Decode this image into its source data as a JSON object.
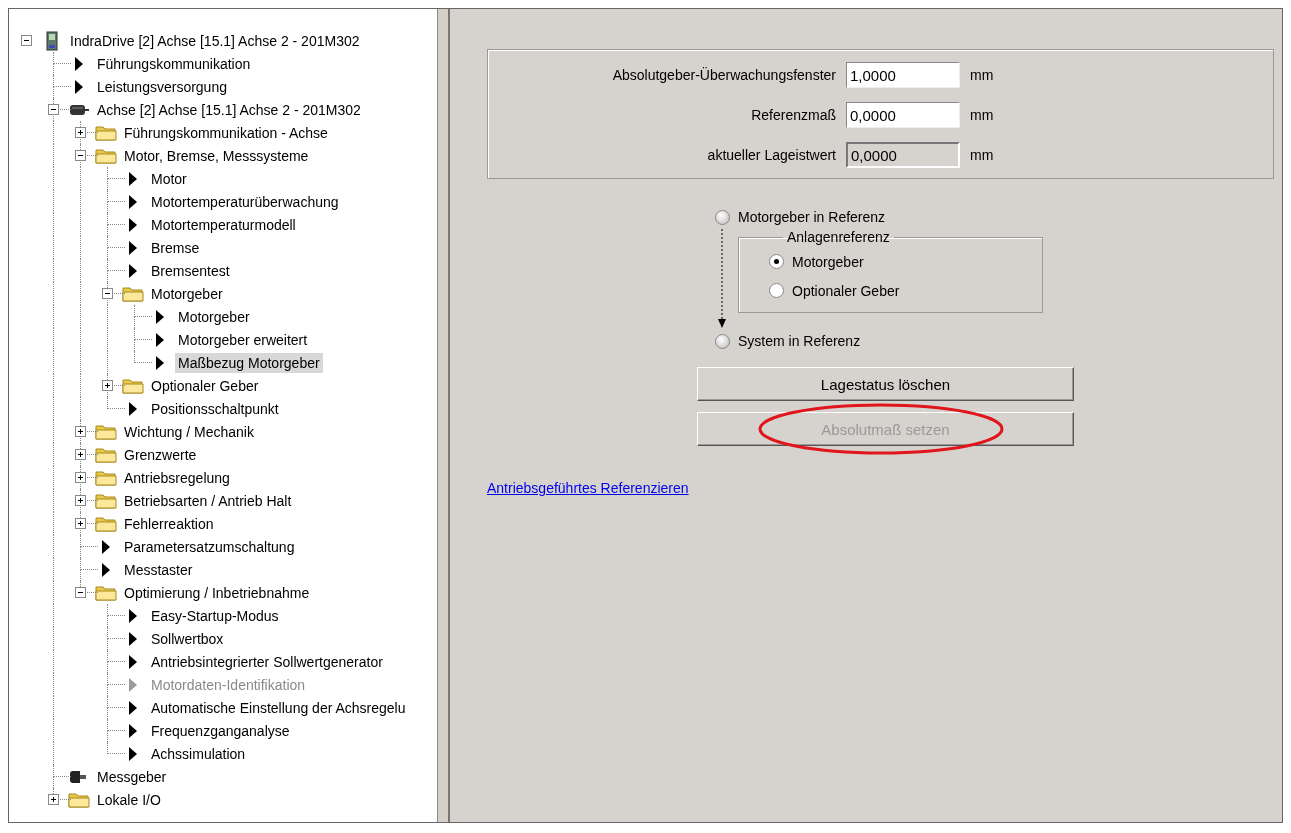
{
  "tree": [
    {
      "label": "IndraDrive [2] Achse [15.1] Achse 2 - 201M302",
      "kind": "device",
      "expanded": true,
      "selected": false,
      "disabled": false,
      "children": [
        {
          "label": "Führungskommunikation",
          "kind": "param",
          "selected": false,
          "disabled": false
        },
        {
          "label": "Leistungsversorgung",
          "kind": "param",
          "selected": false,
          "disabled": false
        },
        {
          "label": "Achse [2] Achse [15.1] Achse 2 - 201M302",
          "kind": "axis",
          "expanded": true,
          "selected": false,
          "disabled": false,
          "children": [
            {
              "label": "Führungskommunikation - Achse",
              "kind": "folder",
              "expanded": false,
              "selected": false,
              "disabled": false
            },
            {
              "label": "Motor, Bremse, Messsysteme",
              "kind": "folder",
              "expanded": true,
              "selected": false,
              "disabled": false,
              "children": [
                {
                  "label": "Motor",
                  "kind": "param",
                  "selected": false,
                  "disabled": false
                },
                {
                  "label": "Motortemperaturüberwachung",
                  "kind": "param",
                  "selected": false,
                  "disabled": false
                },
                {
                  "label": "Motortemperaturmodell",
                  "kind": "param",
                  "selected": false,
                  "disabled": false
                },
                {
                  "label": "Bremse",
                  "kind": "param",
                  "selected": false,
                  "disabled": false
                },
                {
                  "label": "Bremsentest",
                  "kind": "param",
                  "selected": false,
                  "disabled": false
                },
                {
                  "label": "Motorgeber",
                  "kind": "folder",
                  "expanded": true,
                  "selected": false,
                  "disabled": false,
                  "children": [
                    {
                      "label": "Motorgeber",
                      "kind": "param",
                      "selected": false,
                      "disabled": false
                    },
                    {
                      "label": "Motorgeber erweitert",
                      "kind": "param",
                      "selected": false,
                      "disabled": false
                    },
                    {
                      "label": "Maßbezug Motorgeber",
                      "kind": "param",
                      "selected": true,
                      "disabled": false
                    }
                  ]
                },
                {
                  "label": "Optionaler Geber",
                  "kind": "folder",
                  "expanded": false,
                  "selected": false,
                  "disabled": false
                },
                {
                  "label": "Positionsschaltpunkt",
                  "kind": "param",
                  "selected": false,
                  "disabled": false
                }
              ]
            },
            {
              "label": "Wichtung / Mechanik",
              "kind": "folder",
              "expanded": false,
              "selected": false,
              "disabled": false
            },
            {
              "label": "Grenzwerte",
              "kind": "folder",
              "expanded": false,
              "selected": false,
              "disabled": false
            },
            {
              "label": "Antriebsregelung",
              "kind": "folder",
              "expanded": false,
              "selected": false,
              "disabled": false
            },
            {
              "label": "Betriebsarten / Antrieb Halt",
              "kind": "folder",
              "expanded": false,
              "selected": false,
              "disabled": false
            },
            {
              "label": "Fehlerreaktion",
              "kind": "folder",
              "expanded": false,
              "selected": false,
              "disabled": false
            },
            {
              "label": "Parametersatzumschaltung",
              "kind": "param",
              "selected": false,
              "disabled": false
            },
            {
              "label": "Messtaster",
              "kind": "param",
              "selected": false,
              "disabled": false
            },
            {
              "label": "Optimierung / Inbetriebnahme",
              "kind": "folder",
              "expanded": true,
              "selected": false,
              "disabled": false,
              "children": [
                {
                  "label": "Easy-Startup-Modus",
                  "kind": "param",
                  "selected": false,
                  "disabled": false
                },
                {
                  "label": "Sollwertbox",
                  "kind": "param",
                  "selected": false,
                  "disabled": false
                },
                {
                  "label": "Antriebsintegrierter Sollwertgenerator",
                  "kind": "param",
                  "selected": false,
                  "disabled": false
                },
                {
                  "label": "Motordaten-Identifikation",
                  "kind": "param",
                  "selected": false,
                  "disabled": true
                },
                {
                  "label": "Automatische Einstellung der Achsregelu",
                  "kind": "param",
                  "selected": false,
                  "disabled": false
                },
                {
                  "label": "Frequenzganganalyse",
                  "kind": "param",
                  "selected": false,
                  "disabled": false
                },
                {
                  "label": "Achssimulation",
                  "kind": "param",
                  "selected": false,
                  "disabled": false
                }
              ]
            }
          ]
        },
        {
          "label": "Messgeber",
          "kind": "encoder",
          "selected": false,
          "disabled": false
        },
        {
          "label": "Lokale I/O",
          "kind": "folder",
          "expanded": false,
          "selected": false,
          "disabled": false
        }
      ]
    }
  ],
  "fields": [
    {
      "label": "Absolutgeber-Überwachungsfenster",
      "value": "1,0000",
      "unit": "mm",
      "disabled": false
    },
    {
      "label": "Referenzmaß",
      "value": "0,0000",
      "unit": "mm",
      "disabled": false
    },
    {
      "label": "aktueller Lageistwert",
      "value": "0,0000",
      "unit": "mm",
      "disabled": true
    }
  ],
  "reference": {
    "options": [
      {
        "label": "Motorgeber in Referenz",
        "selected": false
      },
      {
        "label": "System in Referenz",
        "selected": false
      }
    ],
    "group": {
      "title": "Anlagenreferenz",
      "options": [
        {
          "label": "Motorgeber",
          "selected": true
        },
        {
          "label": "Optionaler Geber",
          "selected": false
        }
      ]
    }
  },
  "buttons": [
    {
      "label": "Lagestatus löschen",
      "disabled": false,
      "highlighted": false
    },
    {
      "label": "Absolutmaß setzen",
      "disabled": true,
      "highlighted": true
    }
  ],
  "link": "Antriebsgeführtes Referenzieren"
}
